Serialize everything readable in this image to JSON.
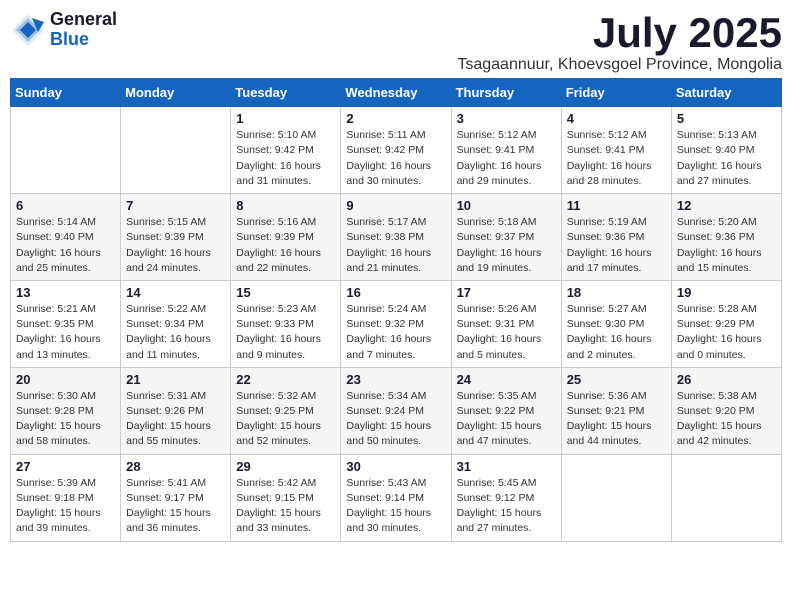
{
  "logo": {
    "general": "General",
    "blue": "Blue"
  },
  "title": {
    "month_year": "July 2025",
    "location": "Tsagaannuur, Khoevsgoel Province, Mongolia"
  },
  "weekdays": [
    "Sunday",
    "Monday",
    "Tuesday",
    "Wednesday",
    "Thursday",
    "Friday",
    "Saturday"
  ],
  "weeks": [
    [
      {
        "day": "",
        "text": ""
      },
      {
        "day": "",
        "text": ""
      },
      {
        "day": "1",
        "text": "Sunrise: 5:10 AM\nSunset: 9:42 PM\nDaylight: 16 hours and 31 minutes."
      },
      {
        "day": "2",
        "text": "Sunrise: 5:11 AM\nSunset: 9:42 PM\nDaylight: 16 hours and 30 minutes."
      },
      {
        "day": "3",
        "text": "Sunrise: 5:12 AM\nSunset: 9:41 PM\nDaylight: 16 hours and 29 minutes."
      },
      {
        "day": "4",
        "text": "Sunrise: 5:12 AM\nSunset: 9:41 PM\nDaylight: 16 hours and 28 minutes."
      },
      {
        "day": "5",
        "text": "Sunrise: 5:13 AM\nSunset: 9:40 PM\nDaylight: 16 hours and 27 minutes."
      }
    ],
    [
      {
        "day": "6",
        "text": "Sunrise: 5:14 AM\nSunset: 9:40 PM\nDaylight: 16 hours and 25 minutes."
      },
      {
        "day": "7",
        "text": "Sunrise: 5:15 AM\nSunset: 9:39 PM\nDaylight: 16 hours and 24 minutes."
      },
      {
        "day": "8",
        "text": "Sunrise: 5:16 AM\nSunset: 9:39 PM\nDaylight: 16 hours and 22 minutes."
      },
      {
        "day": "9",
        "text": "Sunrise: 5:17 AM\nSunset: 9:38 PM\nDaylight: 16 hours and 21 minutes."
      },
      {
        "day": "10",
        "text": "Sunrise: 5:18 AM\nSunset: 9:37 PM\nDaylight: 16 hours and 19 minutes."
      },
      {
        "day": "11",
        "text": "Sunrise: 5:19 AM\nSunset: 9:36 PM\nDaylight: 16 hours and 17 minutes."
      },
      {
        "day": "12",
        "text": "Sunrise: 5:20 AM\nSunset: 9:36 PM\nDaylight: 16 hours and 15 minutes."
      }
    ],
    [
      {
        "day": "13",
        "text": "Sunrise: 5:21 AM\nSunset: 9:35 PM\nDaylight: 16 hours and 13 minutes."
      },
      {
        "day": "14",
        "text": "Sunrise: 5:22 AM\nSunset: 9:34 PM\nDaylight: 16 hours and 11 minutes."
      },
      {
        "day": "15",
        "text": "Sunrise: 5:23 AM\nSunset: 9:33 PM\nDaylight: 16 hours and 9 minutes."
      },
      {
        "day": "16",
        "text": "Sunrise: 5:24 AM\nSunset: 9:32 PM\nDaylight: 16 hours and 7 minutes."
      },
      {
        "day": "17",
        "text": "Sunrise: 5:26 AM\nSunset: 9:31 PM\nDaylight: 16 hours and 5 minutes."
      },
      {
        "day": "18",
        "text": "Sunrise: 5:27 AM\nSunset: 9:30 PM\nDaylight: 16 hours and 2 minutes."
      },
      {
        "day": "19",
        "text": "Sunrise: 5:28 AM\nSunset: 9:29 PM\nDaylight: 16 hours and 0 minutes."
      }
    ],
    [
      {
        "day": "20",
        "text": "Sunrise: 5:30 AM\nSunset: 9:28 PM\nDaylight: 15 hours and 58 minutes."
      },
      {
        "day": "21",
        "text": "Sunrise: 5:31 AM\nSunset: 9:26 PM\nDaylight: 15 hours and 55 minutes."
      },
      {
        "day": "22",
        "text": "Sunrise: 5:32 AM\nSunset: 9:25 PM\nDaylight: 15 hours and 52 minutes."
      },
      {
        "day": "23",
        "text": "Sunrise: 5:34 AM\nSunset: 9:24 PM\nDaylight: 15 hours and 50 minutes."
      },
      {
        "day": "24",
        "text": "Sunrise: 5:35 AM\nSunset: 9:22 PM\nDaylight: 15 hours and 47 minutes."
      },
      {
        "day": "25",
        "text": "Sunrise: 5:36 AM\nSunset: 9:21 PM\nDaylight: 15 hours and 44 minutes."
      },
      {
        "day": "26",
        "text": "Sunrise: 5:38 AM\nSunset: 9:20 PM\nDaylight: 15 hours and 42 minutes."
      }
    ],
    [
      {
        "day": "27",
        "text": "Sunrise: 5:39 AM\nSunset: 9:18 PM\nDaylight: 15 hours and 39 minutes."
      },
      {
        "day": "28",
        "text": "Sunrise: 5:41 AM\nSunset: 9:17 PM\nDaylight: 15 hours and 36 minutes."
      },
      {
        "day": "29",
        "text": "Sunrise: 5:42 AM\nSunset: 9:15 PM\nDaylight: 15 hours and 33 minutes."
      },
      {
        "day": "30",
        "text": "Sunrise: 5:43 AM\nSunset: 9:14 PM\nDaylight: 15 hours and 30 minutes."
      },
      {
        "day": "31",
        "text": "Sunrise: 5:45 AM\nSunset: 9:12 PM\nDaylight: 15 hours and 27 minutes."
      },
      {
        "day": "",
        "text": ""
      },
      {
        "day": "",
        "text": ""
      }
    ]
  ]
}
